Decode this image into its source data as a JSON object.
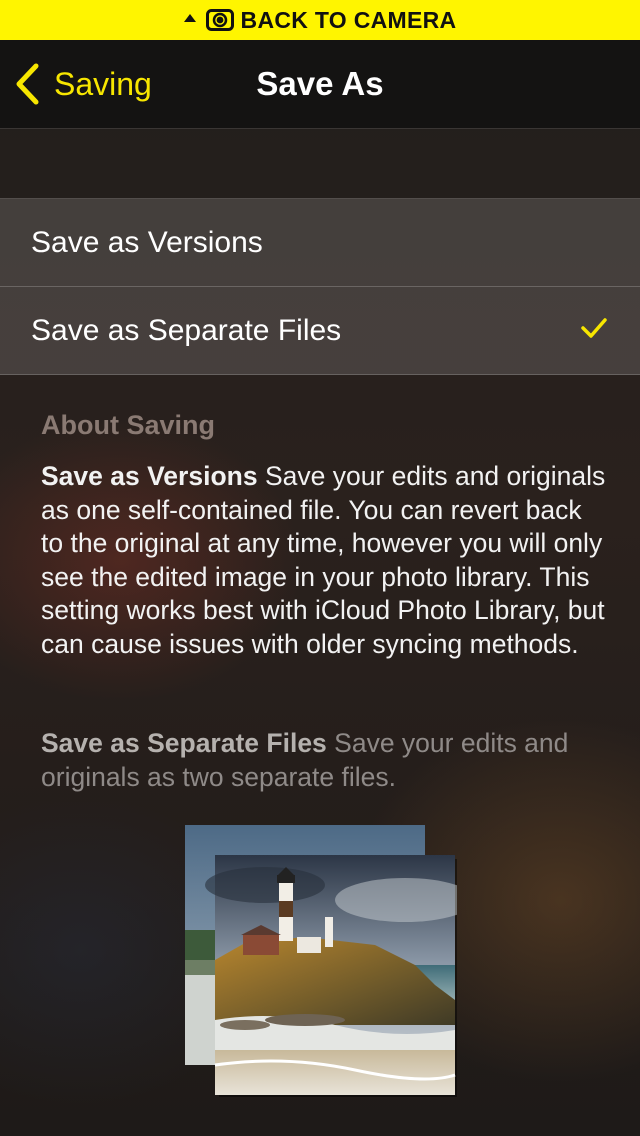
{
  "banner": {
    "label": "BACK TO CAMERA",
    "color": "#fff500"
  },
  "navbar": {
    "back_label": "Saving",
    "title": "Save As",
    "accent_color": "#f7e600"
  },
  "options": [
    {
      "label": "Save as Versions",
      "selected": false
    },
    {
      "label": "Save as Separate Files",
      "selected": true
    }
  ],
  "about": {
    "header": "About Saving",
    "versions_title": "Save as Versions",
    "versions_text": " Save your edits and originals as one self-contained file. You can revert back to the original at any time, however you will only see the edited image in your photo library. This setting works best with iCloud Photo Library, but can cause issues with older syncing methods.",
    "separate_title": "Save as Separate Files",
    "separate_text": " Save your edits and originals as two separate files."
  },
  "icons": {
    "banner_arrow": "up-arrow-icon",
    "banner_camera": "camera-icon",
    "back": "chevron-left-icon",
    "selected": "checkmark-icon",
    "illustration": "photo-stack-lighthouse"
  }
}
